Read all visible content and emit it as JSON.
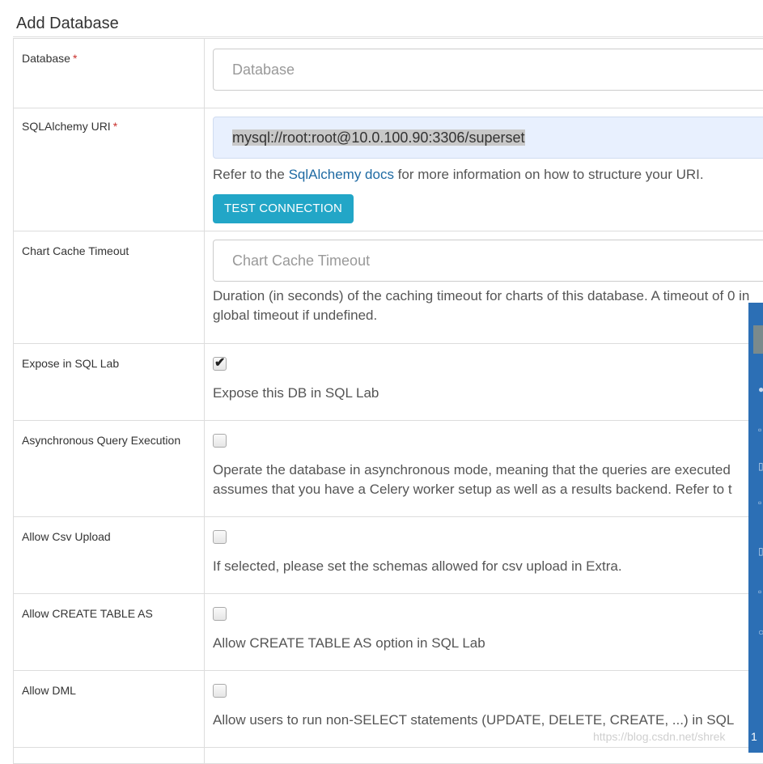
{
  "panel": {
    "title": "Add Database"
  },
  "fields": {
    "database": {
      "label": "Database",
      "required_mark": "*",
      "placeholder": "Database"
    },
    "sqlalchemy_uri": {
      "label": "SQLAlchemy URI",
      "required_mark": "*",
      "value": "mysql://root:root@10.0.100.90:3306/superset",
      "help_before": "Refer to the ",
      "help_link": "SqlAlchemy docs",
      "help_after": " for more information on how to structure your URI.",
      "test_button": "TEST CONNECTION"
    },
    "chart_cache_timeout": {
      "label": "Chart Cache Timeout",
      "placeholder": "Chart Cache Timeout",
      "help_line1": "Duration (in seconds) of the caching timeout for charts of this database. A timeout of 0 in",
      "help_line2": "global timeout if undefined."
    },
    "expose_in_sqllab": {
      "label": "Expose in SQL Lab",
      "checked": true,
      "help": "Expose this DB in SQL Lab"
    },
    "allow_run_async": {
      "label": "Asynchronous Query Execution",
      "checked": false,
      "help_line1": "Operate the database in asynchronous mode, meaning that the queries are executed",
      "help_line2": "assumes that you have a Celery worker setup as well as a results backend. Refer to t"
    },
    "allow_csv_upload": {
      "label": "Allow Csv Upload",
      "checked": false,
      "help": "If selected, please set the schemas allowed for csv upload in Extra."
    },
    "allow_ctas": {
      "label": "Allow CREATE TABLE AS",
      "checked": false,
      "help": "Allow CREATE TABLE AS option in SQL Lab"
    },
    "allow_dml": {
      "label": "Allow DML",
      "checked": false,
      "help": "Allow users to run non-SELECT statements (UPDATE, DELETE, CREATE, ...) in SQL"
    }
  },
  "checkmark_glyph": "✔",
  "watermark": "https://blog.csdn.net/shrek",
  "side_strip_text": "1",
  "colors": {
    "required": "#c9302c",
    "button_bg": "#22a6c7",
    "link": "#1e6aa3",
    "autofill_bg": "#e8f0fe",
    "side_strip": "#2c6fb5"
  }
}
